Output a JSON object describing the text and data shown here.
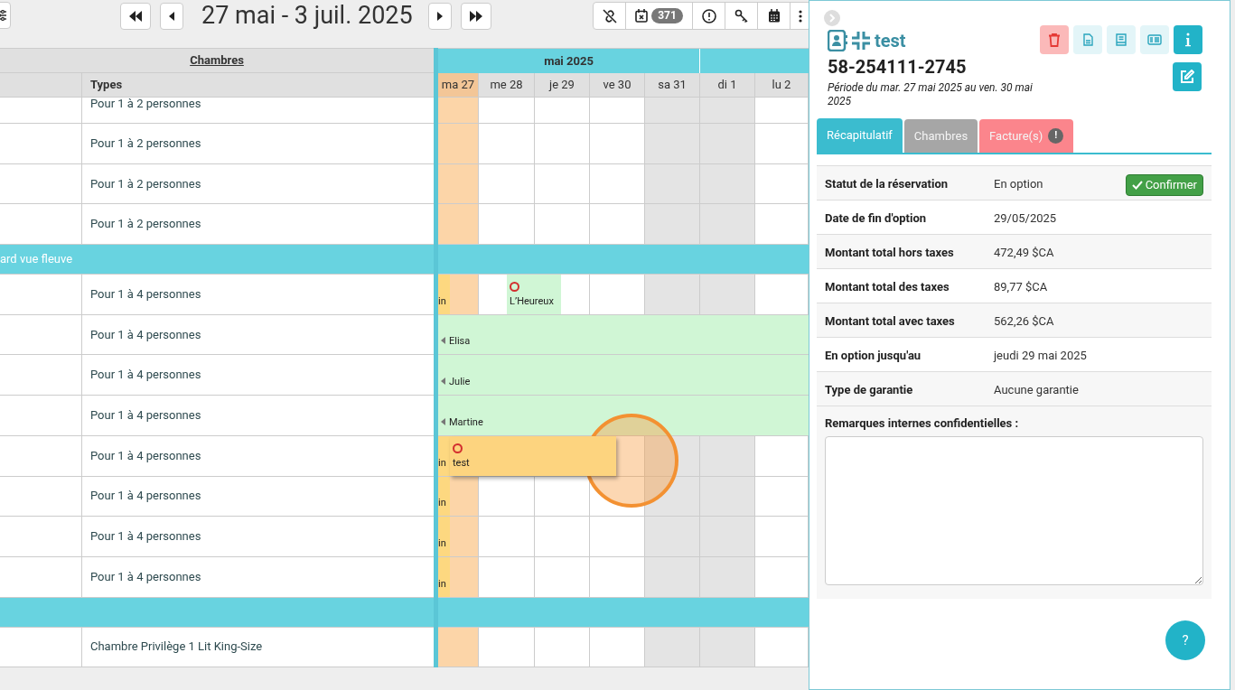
{
  "toolbar": {
    "date_range": "27 mai - 3 juil. 2025",
    "badge": "371"
  },
  "grid": {
    "rooms_heading": "Chambres",
    "types_heading": "Types",
    "month": "mai 2025",
    "days": [
      {
        "label": "ma 27",
        "today": true,
        "weekend": false
      },
      {
        "label": "me 28",
        "today": false,
        "weekend": false
      },
      {
        "label": "je 29",
        "today": false,
        "weekend": false
      },
      {
        "label": "ve 30",
        "today": false,
        "weekend": false
      },
      {
        "label": "sa 31",
        "today": false,
        "weekend": true
      },
      {
        "label": "di 1",
        "today": false,
        "weekend": true
      },
      {
        "label": "lu 2",
        "today": false,
        "weekend": false
      }
    ],
    "rows": [
      {
        "kind": "partial",
        "type": "Pour 1 à 2 personnes",
        "bookings": []
      },
      {
        "kind": "room",
        "type": "Pour 1 à 2 personnes",
        "bookings": []
      },
      {
        "kind": "room",
        "type": "Pour 1 à 2 personnes",
        "bookings": []
      },
      {
        "kind": "room",
        "type": "Pour 1 à 2 personnes",
        "bookings": []
      },
      {
        "kind": "group",
        "label": "ard vue fleuve"
      },
      {
        "kind": "room",
        "type": "Pour 1 à 4 personnes",
        "bookings": [
          {
            "kind": "stub",
            "label": "in",
            "flagged": false,
            "continues_before": false
          },
          {
            "kind": "short",
            "label": "L’Heureux",
            "flagged": true,
            "continues_before": false
          }
        ]
      },
      {
        "kind": "room",
        "type": "Pour 1 à 4 personnes",
        "bookings": [
          {
            "kind": "long",
            "label": "Elisa",
            "flagged": false,
            "continues_before": true
          }
        ]
      },
      {
        "kind": "room",
        "type": "Pour 1 à 4 personnes",
        "bookings": [
          {
            "kind": "long",
            "label": "Julie",
            "flagged": false,
            "continues_before": true
          }
        ]
      },
      {
        "kind": "room",
        "type": "Pour 1 à 4 personnes",
        "bookings": [
          {
            "kind": "long",
            "label": "Martine",
            "flagged": false,
            "continues_before": true
          }
        ]
      },
      {
        "kind": "room",
        "type": "Pour 1 à 4 personnes",
        "bookings": [
          {
            "kind": "stub",
            "label": "in",
            "flagged": false,
            "continues_before": false
          },
          {
            "kind": "hold",
            "label": "test",
            "flagged": true,
            "continues_before": false
          }
        ]
      },
      {
        "kind": "room",
        "type": "Pour 1 à 4 personnes",
        "bookings": [
          {
            "kind": "stub",
            "label": "in",
            "flagged": false,
            "continues_before": false
          }
        ]
      },
      {
        "kind": "room",
        "type": "Pour 1 à 4 personnes",
        "bookings": [
          {
            "kind": "stub",
            "label": "in",
            "flagged": false,
            "continues_before": false
          }
        ]
      },
      {
        "kind": "room",
        "type": "Pour 1 à 4 personnes",
        "bookings": [
          {
            "kind": "stub",
            "label": "in",
            "flagged": false,
            "continues_before": false
          }
        ]
      },
      {
        "kind": "group",
        "label": ""
      },
      {
        "kind": "room",
        "type": "Chambre Privilège 1 Lit King-Size",
        "bookings": []
      }
    ]
  },
  "panel": {
    "client": "test",
    "reference": "58-254111-2745",
    "period": "Période du mar. 27 mai 2025 au ven. 30 mai 2025",
    "tabs": [
      {
        "label": "Récapitulatif",
        "selected": true,
        "color": "#3bbccf"
      },
      {
        "label": "Chambres",
        "selected": false,
        "color": "#a6a6a6"
      },
      {
        "label": "Facture(s)",
        "selected": false,
        "color": "#fb858c",
        "badge": "!"
      }
    ],
    "details": [
      {
        "label": "Statut de la réservation",
        "value": "En option",
        "action": "Confirmer"
      },
      {
        "label": "Date de fin d'option",
        "value": "29/05/2025"
      },
      {
        "label": "Montant total hors taxes",
        "value": "472,49 $CA"
      },
      {
        "label": "Montant total des taxes",
        "value": "89,77 $CA"
      },
      {
        "label": "Montant total avec taxes",
        "value": "562,26 $CA"
      },
      {
        "label": "En option jusqu'au",
        "value": "jeudi 29 mai 2025"
      },
      {
        "label": "Type de garantie",
        "value": "Aucune garantie"
      }
    ],
    "remarks_label": "Remarques internes confidentielles :"
  },
  "help_button": "?"
}
